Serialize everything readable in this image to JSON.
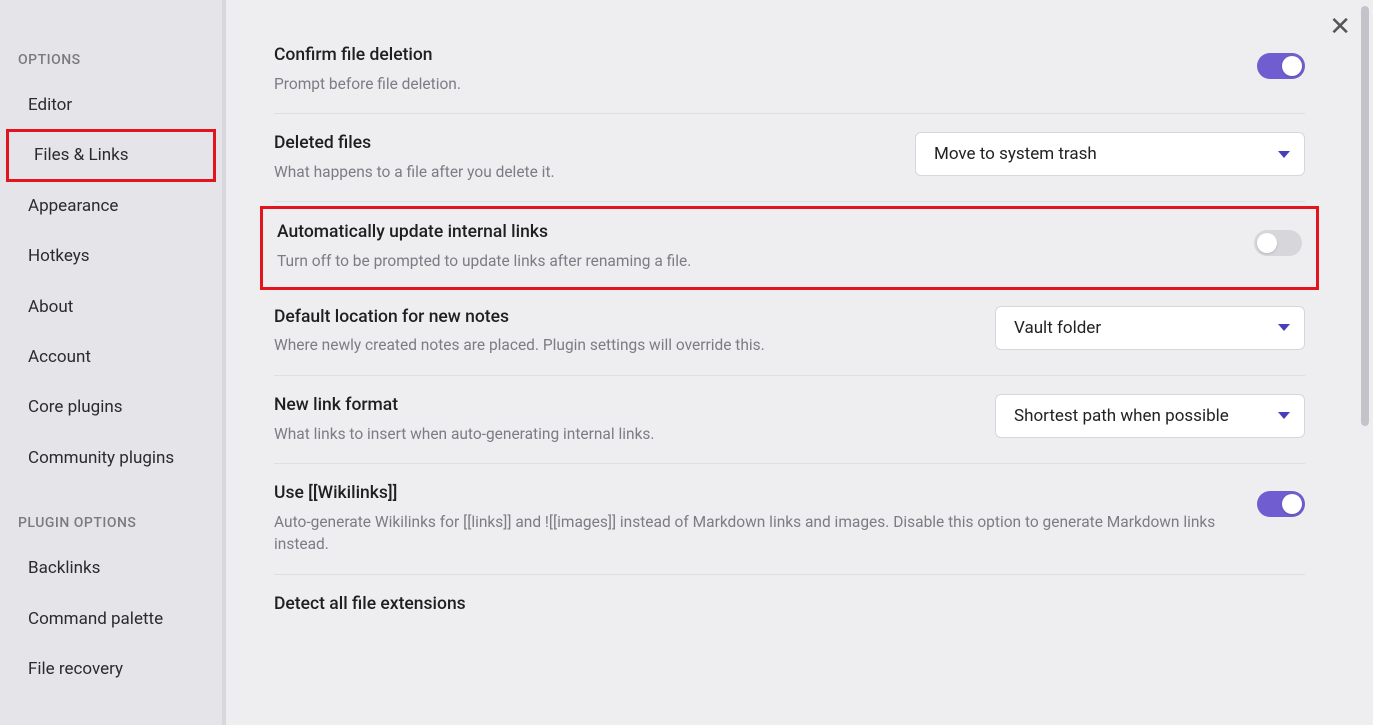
{
  "sidebar": {
    "section1_header": "OPTIONS",
    "section2_header": "PLUGIN OPTIONS",
    "items1": [
      {
        "label": "Editor",
        "active": false
      },
      {
        "label": "Files & Links",
        "active": true
      },
      {
        "label": "Appearance",
        "active": false
      },
      {
        "label": "Hotkeys",
        "active": false
      },
      {
        "label": "About",
        "active": false
      },
      {
        "label": "Account",
        "active": false
      },
      {
        "label": "Core plugins",
        "active": false
      },
      {
        "label": "Community plugins",
        "active": false
      }
    ],
    "items2": [
      {
        "label": "Backlinks"
      },
      {
        "label": "Command palette"
      },
      {
        "label": "File recovery"
      }
    ]
  },
  "settings": {
    "confirm_delete": {
      "title": "Confirm file deletion",
      "desc": "Prompt before file deletion.",
      "toggle_on": true
    },
    "deleted_files": {
      "title": "Deleted files",
      "desc": "What happens to a file after you delete it.",
      "dropdown_value": "Move to system trash"
    },
    "auto_update_links": {
      "title": "Automatically update internal links",
      "desc": "Turn off to be prompted to update links after renaming a file.",
      "toggle_on": false,
      "highlighted": true
    },
    "default_location": {
      "title": "Default location for new notes",
      "desc": "Where newly created notes are placed. Plugin settings will override this.",
      "dropdown_value": "Vault folder"
    },
    "new_link_format": {
      "title": "New link format",
      "desc": "What links to insert when auto-generating internal links.",
      "dropdown_value": "Shortest path when possible"
    },
    "use_wikilinks": {
      "title": "Use [[Wikilinks]]",
      "desc": "Auto-generate Wikilinks for [[links]] and ![[images]] instead of Markdown links and images. Disable this option to generate Markdown links instead.",
      "toggle_on": true
    },
    "detect_ext": {
      "title": "Detect all file extensions"
    }
  },
  "ui": {
    "close_glyph": "✕"
  },
  "colors": {
    "accent": "#705dcf",
    "highlight_border": "#e2141e"
  }
}
